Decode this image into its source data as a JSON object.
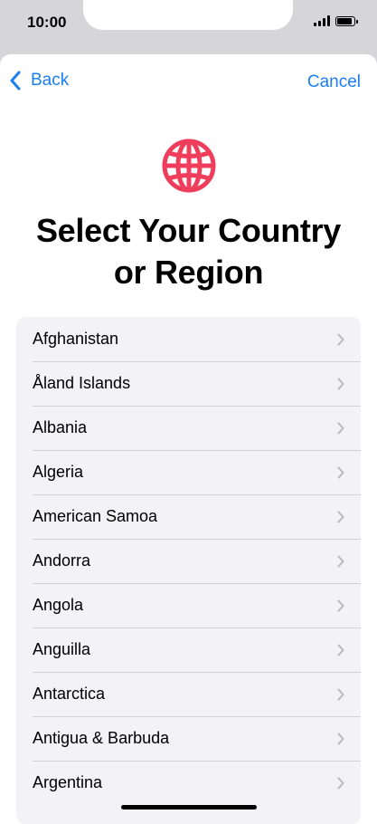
{
  "status_bar": {
    "time": "10:00",
    "battery_level": 0.85
  },
  "nav": {
    "back_label": "Back",
    "cancel_label": "Cancel"
  },
  "header": {
    "icon": "globe-icon",
    "icon_color": "#ee3e5c",
    "title_line1": "Select Your Country",
    "title_line2": "or Region"
  },
  "accent_color": "#1a7ff2",
  "countries": [
    "Afghanistan",
    "Åland Islands",
    "Albania",
    "Algeria",
    "American Samoa",
    "Andorra",
    "Angola",
    "Anguilla",
    "Antarctica",
    "Antigua & Barbuda",
    "Argentina"
  ]
}
